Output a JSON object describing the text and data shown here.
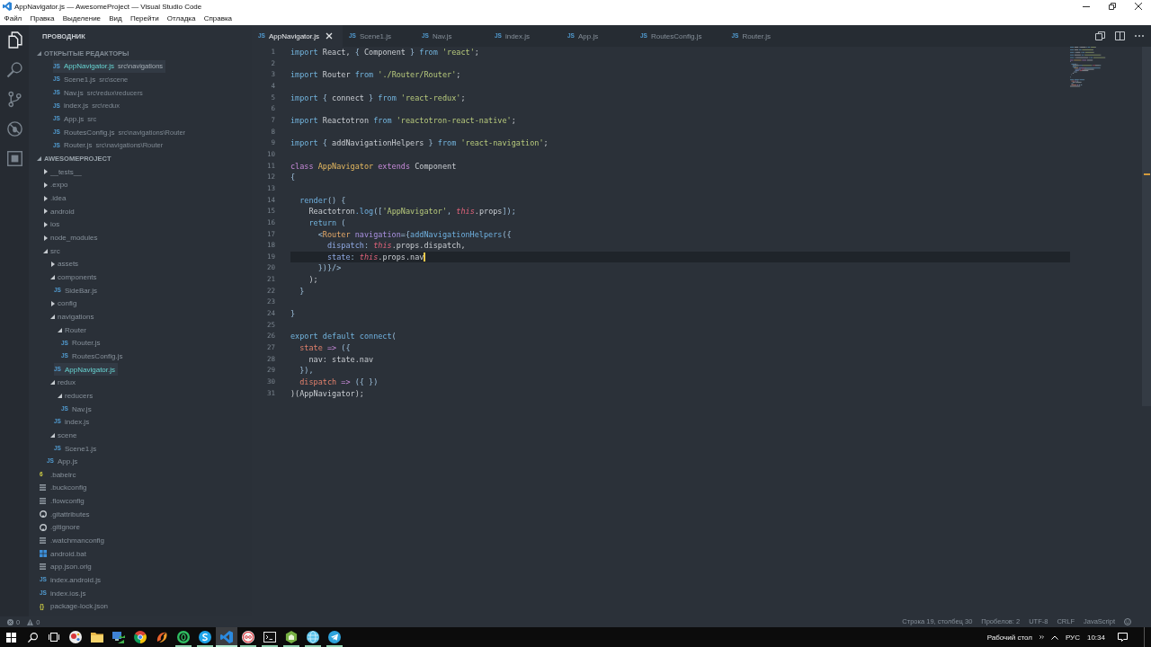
{
  "window": {
    "title": "AppNavigator.js — AwesomeProject — Visual Studio Code"
  },
  "menu": [
    "Файл",
    "Правка",
    "Выделение",
    "Вид",
    "Перейти",
    "Отладка",
    "Справка"
  ],
  "activity_bar": [
    {
      "kind": "explorer",
      "selected": true
    },
    {
      "kind": "search",
      "selected": false
    },
    {
      "kind": "scm",
      "selected": false
    },
    {
      "kind": "debug",
      "selected": false
    },
    {
      "kind": "extensions",
      "selected": false
    }
  ],
  "explorer": {
    "title": "ПРОВОДНИК",
    "open_editors": {
      "title": "ОТКРЫТЫЕ РЕДАКТОРЫ",
      "expanded": true,
      "items": [
        {
          "kind": "js",
          "glyph": "JS",
          "name": "AppNavigator.js",
          "path": "src\\navigations",
          "selected": true
        },
        {
          "kind": "js",
          "glyph": "JS",
          "name": "Scene1.js",
          "path": "src\\scene",
          "selected": false
        },
        {
          "kind": "js",
          "glyph": "JS",
          "name": "Nav.js",
          "path": "src\\redux\\reducers",
          "selected": false
        },
        {
          "kind": "js",
          "glyph": "JS",
          "name": "index.js",
          "path": "src\\redux",
          "selected": false
        },
        {
          "kind": "js",
          "glyph": "JS",
          "name": "App.js",
          "path": "src",
          "selected": false
        },
        {
          "kind": "js",
          "glyph": "JS",
          "name": "RoutesConfig.js",
          "path": "src\\navigations\\Router",
          "selected": false
        },
        {
          "kind": "js",
          "glyph": "JS",
          "name": "Router.js",
          "path": "src\\navigations\\Router",
          "selected": false
        }
      ]
    },
    "project": {
      "title": "AWESOMEPROJECT",
      "expanded": true,
      "items": [
        {
          "kind": "folder",
          "name": "__tests__",
          "expanded": false,
          "selected": false
        },
        {
          "kind": "folder",
          "name": ".expo",
          "expanded": false,
          "selected": false
        },
        {
          "kind": "folder",
          "name": ".idea",
          "expanded": false,
          "selected": false
        },
        {
          "kind": "folder",
          "name": "android",
          "expanded": false,
          "selected": false
        },
        {
          "kind": "folder",
          "name": "ios",
          "expanded": false,
          "selected": false
        },
        {
          "kind": "folder",
          "name": "node_modules",
          "expanded": false,
          "selected": false
        },
        {
          "kind": "folder",
          "name": "src",
          "expanded": true,
          "selected": false,
          "children": [
            {
              "kind": "folder",
              "name": "assets",
              "expanded": false,
              "selected": false
            },
            {
              "kind": "folder",
              "name": "components",
              "expanded": true,
              "selected": false,
              "children": [
                {
                  "kind": "js",
                  "glyph": "JS",
                  "name": "SideBar.js",
                  "selected": false
                }
              ]
            },
            {
              "kind": "folder",
              "name": "config",
              "expanded": false,
              "selected": false
            },
            {
              "kind": "folder",
              "name": "navigations",
              "expanded": true,
              "selected": false,
              "children": [
                {
                  "kind": "folder",
                  "name": "Router",
                  "expanded": true,
                  "selected": false,
                  "children": [
                    {
                      "kind": "js",
                      "glyph": "JS",
                      "name": "Router.js",
                      "selected": false
                    },
                    {
                      "kind": "js",
                      "glyph": "JS",
                      "name": "RoutesConfig.js",
                      "selected": false
                    }
                  ]
                },
                {
                  "kind": "js",
                  "glyph": "JS",
                  "name": "AppNavigator.js",
                  "selected": true
                }
              ]
            },
            {
              "kind": "folder",
              "name": "redux",
              "expanded": true,
              "selected": false,
              "children": [
                {
                  "kind": "folder",
                  "name": "reducers",
                  "expanded": true,
                  "selected": false,
                  "children": [
                    {
                      "kind": "js",
                      "glyph": "JS",
                      "name": "Nav.js",
                      "selected": false
                    }
                  ]
                },
                {
                  "kind": "js",
                  "glyph": "JS",
                  "name": "index.js",
                  "selected": false
                }
              ]
            },
            {
              "kind": "folder",
              "name": "scene",
              "expanded": true,
              "selected": false,
              "children": [
                {
                  "kind": "js",
                  "glyph": "JS",
                  "name": "Scene1.js",
                  "selected": false
                }
              ]
            },
            {
              "kind": "js",
              "glyph": "JS",
              "name": "App.js",
              "selected": false
            }
          ]
        },
        {
          "kind": "babel",
          "glyph": "6",
          "name": ".babelrc",
          "selected": false
        },
        {
          "kind": "config",
          "name": ".buckconfig",
          "selected": false
        },
        {
          "kind": "config",
          "name": ".flowconfig",
          "selected": false
        },
        {
          "kind": "git",
          "name": ".gitattributes",
          "selected": false
        },
        {
          "kind": "git",
          "name": ".gitignore",
          "selected": false
        },
        {
          "kind": "config",
          "name": ".watchmanconfig",
          "selected": false
        },
        {
          "kind": "windows",
          "name": "android.bat",
          "selected": false
        },
        {
          "kind": "config",
          "name": "app.json.orig",
          "selected": false
        },
        {
          "kind": "js",
          "glyph": "JS",
          "name": "index.android.js",
          "selected": false
        },
        {
          "kind": "js",
          "glyph": "JS",
          "name": "index.ios.js",
          "selected": false
        },
        {
          "kind": "json",
          "glyph": "{}",
          "name": "package-lock.json",
          "selected": false
        }
      ]
    }
  },
  "editor": {
    "tabs": [
      {
        "kind": "js",
        "glyph": "JS",
        "label": "AppNavigator.js",
        "selected": true
      },
      {
        "kind": "js",
        "glyph": "JS",
        "label": "Scene1.js",
        "selected": false
      },
      {
        "kind": "js",
        "glyph": "JS",
        "label": "Nav.js",
        "selected": false
      },
      {
        "kind": "js",
        "glyph": "JS",
        "label": "index.js",
        "selected": false
      },
      {
        "kind": "js",
        "glyph": "JS",
        "label": "App.js",
        "selected": false
      },
      {
        "kind": "js",
        "glyph": "JS",
        "label": "RoutesConfig.js",
        "selected": false
      },
      {
        "kind": "js",
        "glyph": "JS",
        "label": "Router.js",
        "selected": false
      }
    ],
    "lines": [
      {
        "number": "1",
        "current": false,
        "tokens": [
          {
            "kind": "keyword",
            "text": "import"
          },
          {
            "kind": "plain",
            "text": " React, "
          },
          {
            "kind": "punct",
            "text": "{"
          },
          {
            "kind": "plain",
            "text": " Component "
          },
          {
            "kind": "punct",
            "text": "}"
          },
          {
            "kind": "keyword",
            "text": " from"
          },
          {
            "kind": "string",
            "text": " 'react'"
          },
          {
            "kind": "plain",
            "text": ";"
          }
        ]
      },
      {
        "number": "2",
        "current": false
      },
      {
        "number": "3",
        "current": false,
        "tokens": [
          {
            "kind": "keyword",
            "text": "import"
          },
          {
            "kind": "plain",
            "text": " Router "
          },
          {
            "kind": "keyword",
            "text": "from"
          },
          {
            "kind": "string",
            "text": " './Router/Router'"
          },
          {
            "kind": "plain",
            "text": ";"
          }
        ]
      },
      {
        "number": "4",
        "current": false
      },
      {
        "number": "5",
        "current": false,
        "tokens": [
          {
            "kind": "keyword",
            "text": "import"
          },
          {
            "kind": "punct",
            "text": " {"
          },
          {
            "kind": "plain",
            "text": " connect "
          },
          {
            "kind": "punct",
            "text": "}"
          },
          {
            "kind": "keyword",
            "text": " from"
          },
          {
            "kind": "string",
            "text": " 'react-redux'"
          },
          {
            "kind": "plain",
            "text": ";"
          }
        ]
      },
      {
        "number": "6",
        "current": false
      },
      {
        "number": "7",
        "current": false,
        "tokens": [
          {
            "kind": "keyword",
            "text": "import"
          },
          {
            "kind": "plain",
            "text": " Reactotron "
          },
          {
            "kind": "keyword",
            "text": "from"
          },
          {
            "kind": "string",
            "text": " 'reactotron-react-native'"
          },
          {
            "kind": "plain",
            "text": ";"
          }
        ]
      },
      {
        "number": "8",
        "current": false
      },
      {
        "number": "9",
        "current": false,
        "tokens": [
          {
            "kind": "keyword",
            "text": "import"
          },
          {
            "kind": "punct",
            "text": " {"
          },
          {
            "kind": "plain",
            "text": " addNavigationHelpers "
          },
          {
            "kind": "punct",
            "text": "}"
          },
          {
            "kind": "keyword",
            "text": " from"
          },
          {
            "kind": "string",
            "text": " 'react-navigation'"
          },
          {
            "kind": "plain",
            "text": ";"
          }
        ]
      },
      {
        "number": "10",
        "current": false
      },
      {
        "number": "11",
        "current": false,
        "tokens": [
          {
            "kind": "storage",
            "text": "class"
          },
          {
            "kind": "class",
            "text": " AppNavigator"
          },
          {
            "kind": "storage",
            "text": " extends"
          },
          {
            "kind": "plain",
            "text": " Component"
          }
        ]
      },
      {
        "number": "12",
        "current": false,
        "tokens": [
          {
            "kind": "punct",
            "text": "{"
          }
        ]
      },
      {
        "number": "13",
        "current": false
      },
      {
        "number": "14",
        "current": false,
        "tokens": [
          {
            "kind": "function",
            "text": "  render"
          },
          {
            "kind": "punct",
            "text": "() {"
          }
        ]
      },
      {
        "number": "15",
        "current": false,
        "tokens": [
          {
            "kind": "plain",
            "text": "    Reactotron"
          },
          {
            "kind": "function",
            "text": ".log"
          },
          {
            "kind": "punct",
            "text": "(["
          },
          {
            "kind": "string",
            "text": "'AppNavigator'"
          },
          {
            "kind": "punct",
            "text": ", "
          },
          {
            "kind": "this",
            "text": "this"
          },
          {
            "kind": "plain",
            "text": ".props"
          },
          {
            "kind": "punct",
            "text": "]);"
          }
        ]
      },
      {
        "number": "16",
        "current": false,
        "tokens": [
          {
            "kind": "keyword",
            "text": "    return"
          },
          {
            "kind": "punct",
            "text": " ("
          }
        ]
      },
      {
        "number": "17",
        "current": false,
        "tokens": [
          {
            "kind": "punct",
            "text": "      <"
          },
          {
            "kind": "tag",
            "text": "Router"
          },
          {
            "kind": "attr",
            "text": " navigation"
          },
          {
            "kind": "punct",
            "text": "={"
          },
          {
            "kind": "function",
            "text": "addNavigationHelpers"
          },
          {
            "kind": "punct",
            "text": "({"
          }
        ]
      },
      {
        "number": "18",
        "current": false,
        "tokens": [
          {
            "kind": "property",
            "text": "        dispatch"
          },
          {
            "kind": "punct",
            "text": ": "
          },
          {
            "kind": "this",
            "text": "this"
          },
          {
            "kind": "plain",
            "text": ".props.dispatch,"
          }
        ]
      },
      {
        "number": "19",
        "current": true,
        "tokens": [
          {
            "kind": "property",
            "text": "        state"
          },
          {
            "kind": "punct",
            "text": ": "
          },
          {
            "kind": "this",
            "text": "this"
          },
          {
            "kind": "plain",
            "text": ".props.nav"
          }
        ]
      },
      {
        "number": "20",
        "current": false,
        "tokens": [
          {
            "kind": "punct",
            "text": "      })}/>"
          }
        ]
      },
      {
        "number": "21",
        "current": false,
        "tokens": [
          {
            "kind": "plain",
            "text": "    );"
          }
        ]
      },
      {
        "number": "22",
        "current": false,
        "tokens": [
          {
            "kind": "punct",
            "text": "  }"
          }
        ]
      },
      {
        "number": "23",
        "current": false
      },
      {
        "number": "24",
        "current": false,
        "tokens": [
          {
            "kind": "punct",
            "text": "}"
          }
        ]
      },
      {
        "number": "25",
        "current": false
      },
      {
        "number": "26",
        "current": false,
        "tokens": [
          {
            "kind": "keyword",
            "text": "export default"
          },
          {
            "kind": "function",
            "text": " connect"
          },
          {
            "kind": "punct",
            "text": "("
          }
        ]
      },
      {
        "number": "27",
        "current": false,
        "tokens": [
          {
            "kind": "param",
            "text": "  state"
          },
          {
            "kind": "storage",
            "text": " =>"
          },
          {
            "kind": "punct",
            "text": " ({"
          }
        ]
      },
      {
        "number": "28",
        "current": false,
        "tokens": [
          {
            "kind": "plain",
            "text": "    nav: state.nav"
          }
        ]
      },
      {
        "number": "29",
        "current": false,
        "tokens": [
          {
            "kind": "punct",
            "text": "  }),"
          }
        ]
      },
      {
        "number": "30",
        "current": false,
        "tokens": [
          {
            "kind": "param",
            "text": "  dispatch"
          },
          {
            "kind": "storage",
            "text": " =>"
          },
          {
            "kind": "punct",
            "text": " ({ })"
          }
        ]
      },
      {
        "number": "31",
        "current": false,
        "tokens": [
          {
            "kind": "plain",
            "text": ")(AppNavigator);"
          }
        ]
      }
    ]
  },
  "status_bar": {
    "errors": "0",
    "warnings": "0",
    "items": [
      "Строка 19, столбец 30",
      "Пробелов: 2",
      "UTF-8",
      "CRLF",
      "JavaScript"
    ]
  },
  "taskbar": {
    "apps": [
      {
        "kind": "palette",
        "running": false,
        "selected": false
      },
      {
        "kind": "folder",
        "running": false,
        "selected": false
      },
      {
        "kind": "monitor",
        "running": false,
        "selected": false
      },
      {
        "kind": "tricolor",
        "running": false,
        "selected": false
      },
      {
        "kind": "swirl",
        "running": false,
        "selected": false
      },
      {
        "kind": "ring",
        "running": true,
        "selected": false
      },
      {
        "kind": "curve",
        "running": true,
        "selected": false
      },
      {
        "kind": "ribbon",
        "running": true,
        "selected": true
      },
      {
        "kind": "dots",
        "running": true,
        "selected": false
      },
      {
        "kind": "terminal",
        "running": true,
        "selected": false
      },
      {
        "kind": "hexagon",
        "running": true,
        "selected": false
      },
      {
        "kind": "globe",
        "running": true,
        "selected": false
      },
      {
        "kind": "plane",
        "running": true,
        "selected": false
      }
    ],
    "toolbar_label": "Рабочий стол",
    "language": "РУС",
    "time": "10:34"
  }
}
